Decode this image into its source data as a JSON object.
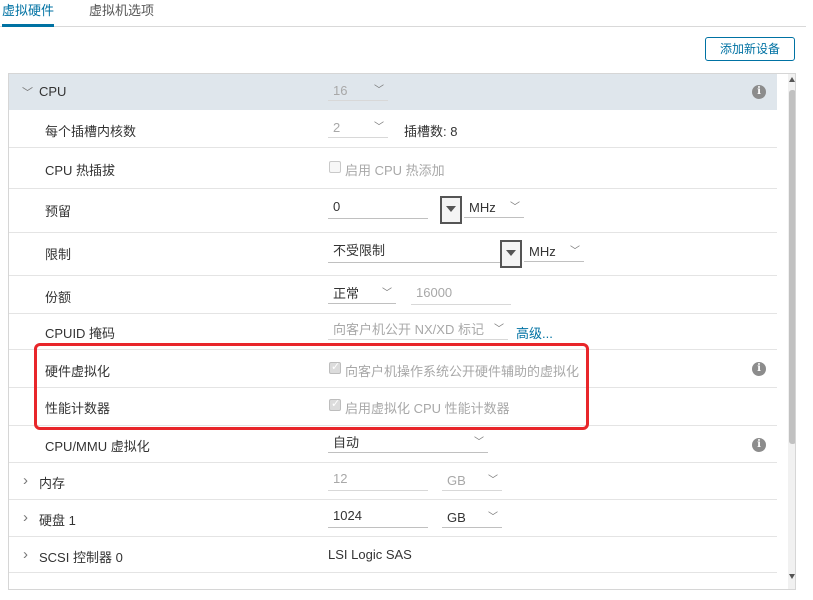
{
  "tabs": [
    {
      "label": "虚拟硬件",
      "active": true
    },
    {
      "label": "虚拟机选项",
      "active": false
    }
  ],
  "add_device_button": "添加新设备",
  "cpu": {
    "title": "CPU",
    "value": "16",
    "cores_label": "每个插槽内核数",
    "cores_value": "2",
    "sockets_text": "插槽数: 8",
    "hotplug_label": "CPU 热插拔",
    "hotplug_checkbox": "启用 CPU 热添加",
    "reservation_label": "预留",
    "reservation_value": "0",
    "reservation_unit": "MHz",
    "limit_label": "限制",
    "limit_value": "不受限制",
    "limit_unit": "MHz",
    "shares_label": "份额",
    "shares_value": "正常",
    "shares_number": "16000",
    "cpuid_label": "CPUID 掩码",
    "cpuid_value": "向客户机公开 NX/XD 标记",
    "cpuid_advanced": "高级...",
    "hwvirt_label": "硬件虚拟化",
    "hwvirt_checkbox": "向客户机操作系统公开硬件辅助的虚拟化",
    "perf_label": "性能计数器",
    "perf_checkbox": "启用虚拟化 CPU 性能计数器",
    "mmu_label": "CPU/MMU 虚拟化",
    "mmu_value": "自动"
  },
  "memory": {
    "label": "内存",
    "value": "12",
    "unit": "GB"
  },
  "disk": {
    "label": "硬盘 1",
    "value": "1024",
    "unit": "GB"
  },
  "scsi": {
    "label": "SCSI 控制器 0",
    "value": "LSI Logic SAS"
  },
  "icons": {
    "info": "i",
    "chevron_down": "﹀",
    "chevron_right": "›"
  },
  "colors": {
    "accent": "#0072a3",
    "highlight": "#e8262a",
    "header_bg": "#dfe6ec"
  }
}
